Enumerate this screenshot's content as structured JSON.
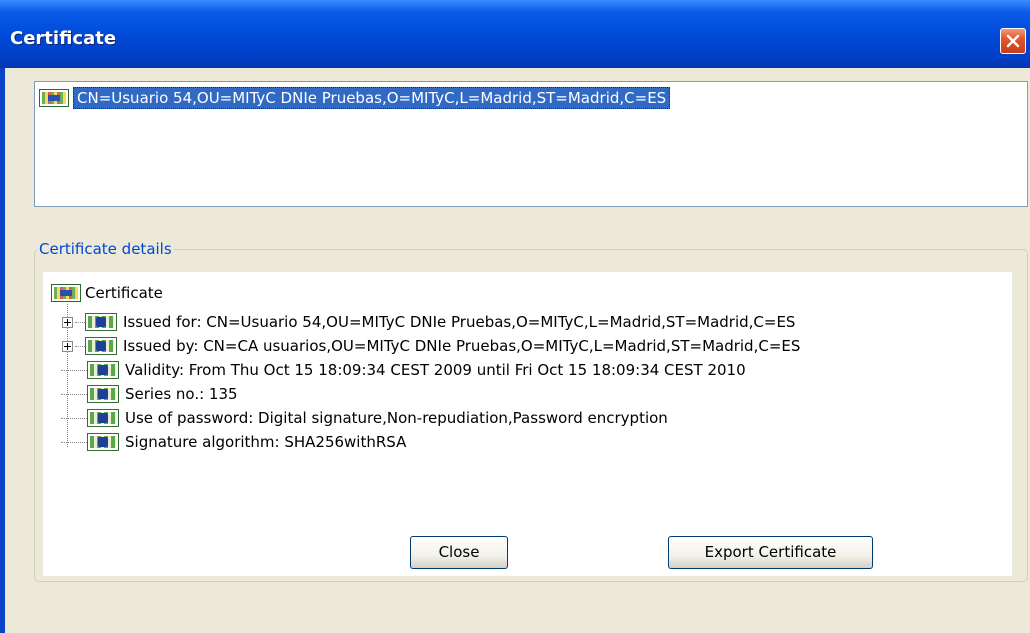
{
  "window": {
    "title": "Certificate",
    "close_icon": "close-x-icon"
  },
  "subject_list": {
    "selected_item": "CN=Usuario 54,OU=MITyC DNIe Pruebas,O=MITyC,L=Madrid,ST=Madrid,C=ES",
    "icon": "certificate-icon"
  },
  "details": {
    "legend": "Certificate details",
    "root_label": "Certificate",
    "items": [
      {
        "label": "Issued for: CN=Usuario 54,OU=MITyC DNIe Pruebas,O=MITyC,L=Madrid,ST=Madrid,C=ES",
        "expandable": true
      },
      {
        "label": "Issued by: CN=CA usuarios,OU=MITyC DNIe Pruebas,O=MITyC,L=Madrid,ST=Madrid,C=ES",
        "expandable": true
      },
      {
        "label": "Validity: From Thu Oct 15 18:09:34 CEST 2009 until Fri Oct 15 18:09:34 CEST 2010",
        "expandable": false
      },
      {
        "label": "Series no.: 135",
        "expandable": false
      },
      {
        "label": "Use of password: Digital signature,Non-repudiation,Password encryption",
        "expandable": false
      },
      {
        "label": "Signature algorithm: SHA256withRSA",
        "expandable": false
      }
    ]
  },
  "buttons": {
    "close": "Close",
    "export": "Export Certificate"
  },
  "colors": {
    "title_bar": "#0048d6",
    "selection": "#316ac5",
    "legend_text": "#0046d5",
    "dialog_bg": "#ece9d8"
  }
}
